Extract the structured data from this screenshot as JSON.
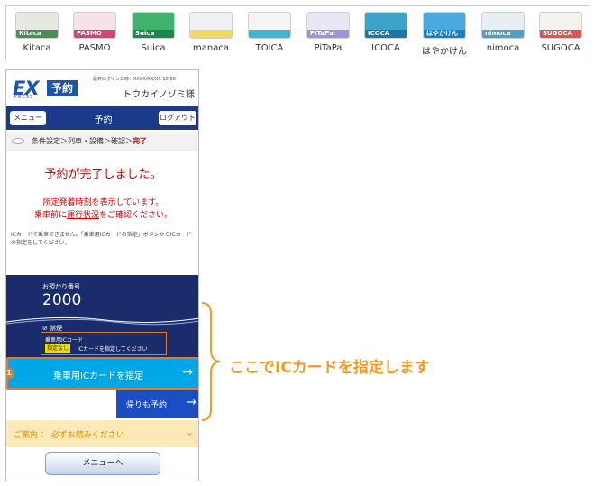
{
  "cards": [
    {
      "name": "Kitaca",
      "bg": "#e8e8e2",
      "accent": "#2f7c3a",
      "text": "Kitaca"
    },
    {
      "name": "PASMO",
      "bg": "#f6e3ea",
      "accent": "#d12760",
      "text": "PASMO"
    },
    {
      "name": "Suica",
      "bg": "#3fb36d",
      "accent": "#1f7c45",
      "text": "Suica"
    },
    {
      "name": "manaca",
      "bg": "#eef0f3",
      "accent": "#f5d34c",
      "text": ""
    },
    {
      "name": "TOICA",
      "bg": "#f4f4f4",
      "accent": "#22a8c8",
      "text": ""
    },
    {
      "name": "PiTaPa",
      "bg": "#e9e7f5",
      "accent": "#8f87cf",
      "text": "PiTaPa"
    },
    {
      "name": "ICOCA",
      "bg": "#3ea3c9",
      "accent": "#1b6d9e",
      "text": "ICOCA"
    },
    {
      "name": "はやかけん",
      "bg": "#4aa9df",
      "accent": "#1779ba",
      "text": "はやかけん"
    },
    {
      "name": "nimoca",
      "bg": "#e8eff3",
      "accent": "#3a8fbd",
      "text": "nimoca"
    },
    {
      "name": "SUGOCA",
      "bg": "#f4f2ee",
      "accent": "#d63a3a",
      "text": "SUGOCA"
    }
  ],
  "header": {
    "logo_ex": "EX",
    "logo_yoyaku": "予約",
    "logo_press": "PRESS",
    "last_login": "最終ログイン日時：XXXX/XX/XX 10:00",
    "user_name": "トウカイノゾミ様"
  },
  "nav": {
    "menu": "メニュー",
    "title": "予約",
    "logout": "ログアウト"
  },
  "steps": {
    "prefix": "条件設定＞列車・設備＞確認＞",
    "current": "完了"
  },
  "complete_title": "予約が完了しました。",
  "notes": {
    "line1": "所定発着時刻を表示しています。",
    "line2_before": "乗車前に",
    "line2_link": "運行状況",
    "line2_after": "をご確認ください。"
  },
  "ic_warning": "ICカードで乗車できません。「乗車用ICカードの指定」ボタンからICカードの指定をしてください。",
  "booking": {
    "number_label": "お預かり番号",
    "number": "2000",
    "smoking": "禁煙",
    "ic_label": "乗車用ICカード",
    "ic_badge": "指定なし",
    "ic_state": "ICカードを指定してください"
  },
  "buttons": {
    "ic_assign": "乗車用ICカードを指定",
    "return": "帰りも予約",
    "menu_back": "メニューへ"
  },
  "badge_number": "1",
  "guide": "ご案内 ： 必ずお読みください",
  "callout": "ここでICカードを指定します",
  "colors": {
    "navy": "#1b2c6d",
    "brand_blue": "#1b56a8",
    "ic_button": "#00a7e6",
    "return_button": "#1b4ec2",
    "annotation": "#f39a1e",
    "alert": "#d60000"
  }
}
